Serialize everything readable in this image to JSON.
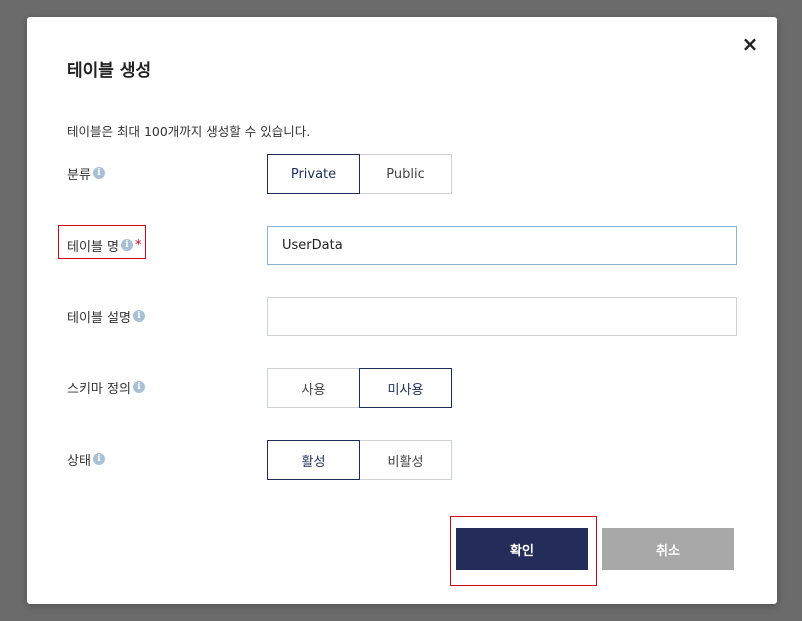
{
  "dialog": {
    "title": "테이블 생성",
    "close_icon": "×",
    "description": "테이블은 최대 100개까지 생성할 수 있습니다."
  },
  "fields": {
    "category": {
      "label": "분류",
      "info_icon": "i",
      "options": [
        "Private",
        "Public"
      ],
      "selected": "Private"
    },
    "table_name": {
      "label": "테이블 명",
      "info_icon": "i",
      "required_mark": "*",
      "value": "UserData",
      "placeholder": ""
    },
    "table_description": {
      "label": "테이블 설명",
      "info_icon": "i",
      "value": "",
      "placeholder": ""
    },
    "schema_definition": {
      "label": "스키마 정의",
      "info_icon": "i",
      "options": [
        "사용",
        "미사용"
      ],
      "selected": "미사용"
    },
    "status": {
      "label": "상태",
      "info_icon": "i",
      "options": [
        "활성",
        "비활성"
      ],
      "selected": "활성"
    }
  },
  "buttons": {
    "confirm": "확인",
    "cancel": "취소"
  },
  "colors": {
    "primary": "#242c5a",
    "secondary": "#a8a8a8",
    "highlight": "#d0021b"
  }
}
